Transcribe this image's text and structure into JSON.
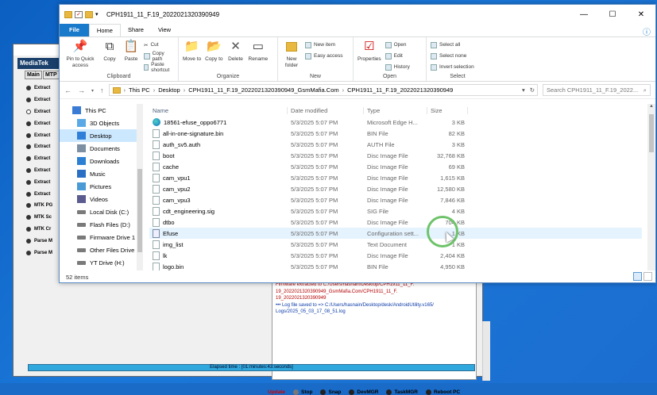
{
  "background_app": {
    "brand": "MediaTek",
    "tabs": [
      "Main",
      "MTP"
    ],
    "radio_items": [
      "Extract",
      "Extract",
      "Extract",
      "Extract",
      "Extract",
      "Extract",
      "Extract",
      "Extract",
      "Extract",
      "Extract",
      "MTK PG",
      "MTK Sc",
      "MTK Cr",
      "Parse M",
      "Parse M"
    ],
    "log_lines": [
      {
        "text": "Firmware extracted to C:/Users/hasnain/Desktop/CPH1911_11_F.",
        "cls": "red"
      },
      {
        "text": "19_2022021320390949_GsmMafia.Com/CPH1911_11_F.",
        "cls": "red"
      },
      {
        "text": "19_2022021320390949",
        "cls": "red"
      },
      {
        "text": "••• Log file saved to => C:/Users/hasnain/Desktop/desk/AndroidUtility.v165/",
        "cls": "blue"
      },
      {
        "text": "Logs/2025_05_03_17_08_51.log",
        "cls": "blue"
      }
    ],
    "buttons": {
      "update": "Update",
      "stop": "Stop",
      "snap": "Snap",
      "devmgr": "DevMGR",
      "taskmgr": "TaskMGR",
      "reboot": "Reboot PC"
    },
    "elapsed": "Elapsed time : [01:minutes:43:seconds]"
  },
  "explorer": {
    "title": "CPH1911_11_F.19_2022021320390949",
    "tabs": {
      "file": "File",
      "home": "Home",
      "share": "Share",
      "view": "View"
    },
    "ribbon": {
      "clipboard": {
        "pin": "Pin to Quick access",
        "copy": "Copy",
        "paste": "Paste",
        "cut": "Cut",
        "copy_path": "Copy path",
        "paste_shortcut": "Paste shortcut",
        "caption": "Clipboard"
      },
      "organize": {
        "move_to": "Move to",
        "copy_to": "Copy to",
        "delete": "Delete",
        "rename": "Rename",
        "caption": "Organize"
      },
      "new": {
        "new_folder": "New folder",
        "new_item": "New item",
        "easy_access": "Easy access",
        "caption": "New"
      },
      "open": {
        "properties": "Properties",
        "open": "Open",
        "edit": "Edit",
        "history": "History",
        "caption": "Open"
      },
      "select": {
        "select_all": "Select all",
        "select_none": "Select none",
        "invert": "Invert selection",
        "caption": "Select"
      }
    },
    "breadcrumbs": [
      "This PC",
      "Desktop",
      "CPH1911_11_F.19_2022021320390949_GsmMafia.Com",
      "CPH1911_11_F.19_2022021320390949"
    ],
    "search_placeholder": "Search CPH1911_11_F.19_2022...",
    "nav_items": [
      {
        "label": "This PC",
        "icon": "pc-icon"
      },
      {
        "label": "3D Objects",
        "icon": "cube-icon"
      },
      {
        "label": "Desktop",
        "icon": "desktop-icon"
      },
      {
        "label": "Documents",
        "icon": "documents-icon"
      },
      {
        "label": "Downloads",
        "icon": "downloads-icon"
      },
      {
        "label": "Music",
        "icon": "music-icon"
      },
      {
        "label": "Pictures",
        "icon": "pictures-icon"
      },
      {
        "label": "Videos",
        "icon": "videos-icon"
      },
      {
        "label": "Local Disk (C:)",
        "icon": "drive-icon"
      },
      {
        "label": "Flash Files (D:)",
        "icon": "drive-icon"
      },
      {
        "label": "Firmware Drive 1",
        "icon": "drive-icon"
      },
      {
        "label": "Other Files Drive",
        "icon": "drive-icon"
      },
      {
        "label": "YT Drive (H:)",
        "icon": "drive-icon"
      }
    ],
    "columns": [
      "Name",
      "Date modified",
      "Type",
      "Size"
    ],
    "files": [
      {
        "name": "18561-efuse_oppo6771",
        "date": "5/3/2025 5:07 PM",
        "type": "Microsoft Edge H...",
        "size": "3 KB",
        "icon": "edge"
      },
      {
        "name": "all-in-one-signature.bin",
        "date": "5/3/2025 5:07 PM",
        "type": "BIN File",
        "size": "82 KB",
        "icon": "file"
      },
      {
        "name": "auth_sv5.auth",
        "date": "5/3/2025 5:07 PM",
        "type": "AUTH File",
        "size": "3 KB",
        "icon": "file"
      },
      {
        "name": "boot",
        "date": "5/3/2025 5:07 PM",
        "type": "Disc Image File",
        "size": "32,768 KB",
        "icon": "file"
      },
      {
        "name": "cache",
        "date": "5/3/2025 5:07 PM",
        "type": "Disc Image File",
        "size": "69 KB",
        "icon": "file"
      },
      {
        "name": "cam_vpu1",
        "date": "5/3/2025 5:07 PM",
        "type": "Disc Image File",
        "size": "1,615 KB",
        "icon": "file"
      },
      {
        "name": "cam_vpu2",
        "date": "5/3/2025 5:07 PM",
        "type": "Disc Image File",
        "size": "12,580 KB",
        "icon": "file"
      },
      {
        "name": "cam_vpu3",
        "date": "5/3/2025 5:07 PM",
        "type": "Disc Image File",
        "size": "7,846 KB",
        "icon": "file"
      },
      {
        "name": "cdt_engineering.sig",
        "date": "5/3/2025 5:07 PM",
        "type": "SIG File",
        "size": "4 KB",
        "icon": "file"
      },
      {
        "name": "dtbo",
        "date": "5/3/2025 5:07 PM",
        "type": "Disc Image File",
        "size": "704 KB",
        "icon": "file"
      },
      {
        "name": "Efuse",
        "date": "5/3/2025 5:07 PM",
        "type": "Configuration sett...",
        "size": "1 KB",
        "icon": "cfg",
        "hover": true
      },
      {
        "name": "img_list",
        "date": "5/3/2025 5:07 PM",
        "type": "Text Document",
        "size": "1 KB",
        "icon": "file"
      },
      {
        "name": "lk",
        "date": "5/3/2025 5:07 PM",
        "type": "Disc Image File",
        "size": "2,404 KB",
        "icon": "file"
      },
      {
        "name": "logo.bin",
        "date": "5/3/2025 5:07 PM",
        "type": "BIN File",
        "size": "4,950 KB",
        "icon": "file"
      }
    ],
    "status": "52 items"
  }
}
